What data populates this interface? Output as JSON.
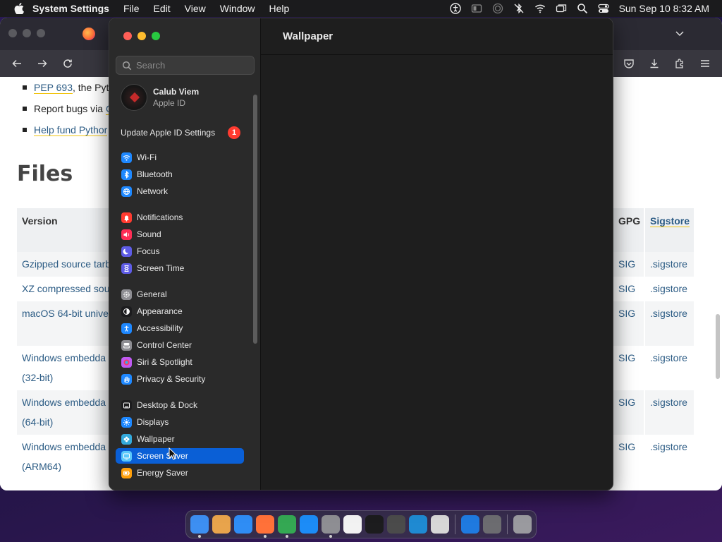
{
  "menubar": {
    "app_name": "System Settings",
    "menus": [
      "File",
      "Edit",
      "View",
      "Window",
      "Help"
    ],
    "clock": "Sun Sep 10  8:32 AM",
    "status_icons": [
      "accessibility-icon",
      "display-icon",
      "airdrop-icon",
      "bluetooth-off-icon",
      "wifi-icon",
      "screen-mirroring-icon",
      "spotlight-search-icon",
      "control-center-icon"
    ]
  },
  "browser": {
    "bullets": [
      {
        "link": "PEP 693",
        "text": ", the Pyth"
      },
      {
        "text": "Report bugs via ",
        "link": "G"
      },
      {
        "link": "Help fund Pythor",
        "text": ""
      }
    ],
    "files_heading": "Files",
    "table": {
      "h_version": "Version",
      "h_gpg": "GPG",
      "h_sigstore": "Sigstore",
      "rows": [
        {
          "name": "Gzipped source tarb",
          "name2": "",
          "sig": "SIG",
          "sigstore": ".sigstore"
        },
        {
          "name": "XZ compressed sou",
          "name2": "",
          "sig": "SIG",
          "sigstore": ".sigstore"
        },
        {
          "name": "macOS 64-bit unive",
          "name2": "",
          "sig": "SIG",
          "sigstore": ".sigstore"
        },
        {
          "name": "Windows embedda",
          "name2": "(32-bit)",
          "sig": "SIG",
          "sigstore": ".sigstore"
        },
        {
          "name": "Windows embedda",
          "name2": "(64-bit)",
          "sig": "SIG",
          "sigstore": ".sigstore"
        },
        {
          "name": "Windows embedda",
          "name2": "(ARM64)",
          "sig": "SIG",
          "sigstore": ".sigstore"
        }
      ]
    }
  },
  "settings": {
    "search_placeholder": "Search",
    "apple_id": {
      "name": "Calub Viem",
      "subtitle": "Apple ID"
    },
    "update": {
      "label": "Update Apple ID Settings",
      "badge": "1"
    },
    "content_title": "Wallpaper",
    "nav": [
      {
        "label": "Wi-Fi",
        "icon": "wifi-icon",
        "color": "#1e88ff"
      },
      {
        "label": "Bluetooth",
        "icon": "bluetooth-icon",
        "color": "#1e88ff"
      },
      {
        "label": "Network",
        "icon": "globe-icon",
        "color": "#1e88ff"
      },
      {
        "label": "Notifications",
        "icon": "bell-icon",
        "color": "#ff3b30"
      },
      {
        "label": "Sound",
        "icon": "speaker-icon",
        "color": "#ff2d55"
      },
      {
        "label": "Focus",
        "icon": "moon-icon",
        "color": "#5e5ce6"
      },
      {
        "label": "Screen Time",
        "icon": "hourglass-icon",
        "color": "#5e5ce6"
      },
      {
        "label": "General",
        "icon": "gear-icon",
        "color": "#8e8e93"
      },
      {
        "label": "Appearance",
        "icon": "appearance-icon",
        "color": "#1c1c1e"
      },
      {
        "label": "Accessibility",
        "icon": "accessibility-icon",
        "color": "#1e88ff"
      },
      {
        "label": "Control Center",
        "icon": "control-center-icon",
        "color": "#8e8e93"
      },
      {
        "label": "Siri & Spotlight",
        "icon": "siri-icon",
        "color": "#bf5af2"
      },
      {
        "label": "Privacy & Security",
        "icon": "hand-icon",
        "color": "#1e88ff"
      },
      {
        "label": "Desktop & Dock",
        "icon": "dock-icon",
        "color": "#1c1c1e"
      },
      {
        "label": "Displays",
        "icon": "sun-icon",
        "color": "#1e88ff"
      },
      {
        "label": "Wallpaper",
        "icon": "flower-icon",
        "color": "#34aadc"
      },
      {
        "label": "Screen Saver",
        "icon": "screensaver-icon",
        "color": "#5ac8fa"
      },
      {
        "label": "Energy Saver",
        "icon": "battery-icon",
        "color": "#ff9f0a"
      }
    ]
  },
  "dock": {
    "apps": [
      {
        "name": "finder-icon",
        "color": "#3d8ff2",
        "running": true
      },
      {
        "name": "launchpad-icon",
        "color": "#e8a44c",
        "running": false
      },
      {
        "name": "safari-icon",
        "color": "#2f8df5",
        "running": false
      },
      {
        "name": "firefox-icon",
        "color": "#ff7139",
        "running": true
      },
      {
        "name": "chrome-icon",
        "color": "#34a853",
        "running": true
      },
      {
        "name": "app-store-icon",
        "color": "#1c8cf7",
        "running": false
      },
      {
        "name": "system-settings-icon",
        "color": "#8e8e93",
        "running": true
      },
      {
        "name": "textedit-icon",
        "color": "#f2f2f2",
        "running": false
      },
      {
        "name": "terminal-icon",
        "color": "#1c1c1e",
        "running": false
      },
      {
        "name": "brush-icon",
        "color": "#4b4b4b",
        "running": false
      },
      {
        "name": "vscode-icon",
        "color": "#1f8ad2",
        "running": false
      },
      {
        "name": "preview-icon",
        "color": "#d7d7d7",
        "running": false
      },
      {
        "name": "keynote-icon",
        "color": "#1f7ae0",
        "running": false
      },
      {
        "name": "rocket-icon",
        "color": "#6c6c70",
        "running": false
      },
      {
        "name": "trash-icon",
        "color": "#9a9a9f",
        "running": false
      }
    ]
  }
}
